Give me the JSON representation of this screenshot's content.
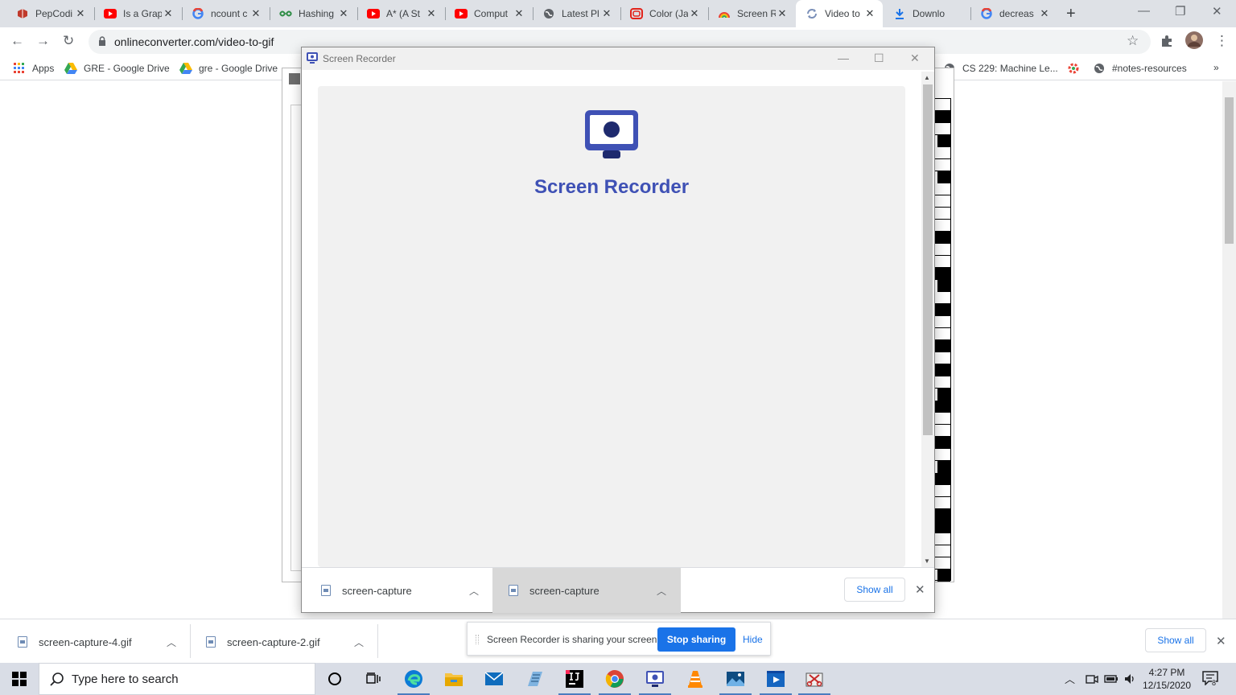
{
  "browser": {
    "tabs": [
      {
        "title": "PepCodi",
        "icon": "pepcoding-icon"
      },
      {
        "title": "Is a Grap",
        "icon": "youtube-icon"
      },
      {
        "title": "ncount c",
        "icon": "google-icon"
      },
      {
        "title": "Hashing",
        "icon": "geeksforgeeks-icon"
      },
      {
        "title": "A* (A St",
        "icon": "youtube-icon"
      },
      {
        "title": "Comput",
        "icon": "youtube-icon"
      },
      {
        "title": "Latest Pl",
        "icon": "globe-icon"
      },
      {
        "title": "Color (Ja",
        "icon": "oracle-icon"
      },
      {
        "title": "Screen R",
        "icon": "chrome-rainbow-icon"
      },
      {
        "title": "Video to",
        "icon": "converter-icon"
      },
      {
        "title": "Downlo",
        "icon": "download-icon"
      },
      {
        "title": "decreas",
        "icon": "google-icon"
      }
    ],
    "url": "onlineconverter.com/video-to-gif",
    "bookmarks": [
      {
        "label": "Apps",
        "icon": "apps-grid-icon"
      },
      {
        "label": "GRE - Google Drive",
        "icon": "google-drive-icon"
      },
      {
        "label": "gre - Google Drive",
        "icon": "google-drive-icon"
      },
      {
        "label": "CS 229: Machine Le...",
        "icon": "globe-icon"
      },
      {
        "label": "",
        "icon": "colorful-gear-icon"
      },
      {
        "label": "#notes-resources",
        "icon": "globe-icon"
      }
    ],
    "bookmarks_overflow": "»"
  },
  "screen_recorder": {
    "window_title": "Screen Recorder",
    "heading": "Screen Recorder",
    "downloads": [
      {
        "name": "screen-capture"
      },
      {
        "name": "screen-capture"
      }
    ],
    "show_all": "Show all"
  },
  "download_shelf": {
    "items": [
      {
        "name": "screen-capture-4.gif"
      },
      {
        "name": "screen-capture-2.gif"
      }
    ],
    "show_all": "Show all"
  },
  "share_bar": {
    "message": "Screen Recorder is sharing your screen.",
    "stop_label": "Stop sharing",
    "hide_label": "Hide"
  },
  "taskbar": {
    "search_placeholder": "Type here to search",
    "time": "4:27 PM",
    "date": "12/15/2020",
    "notification_count": "8"
  },
  "colors": {
    "accent": "#3f51b5",
    "chrome_blue": "#1a73e8",
    "tab_strip": "#dee1e6",
    "taskbar": "#d9dde6"
  }
}
